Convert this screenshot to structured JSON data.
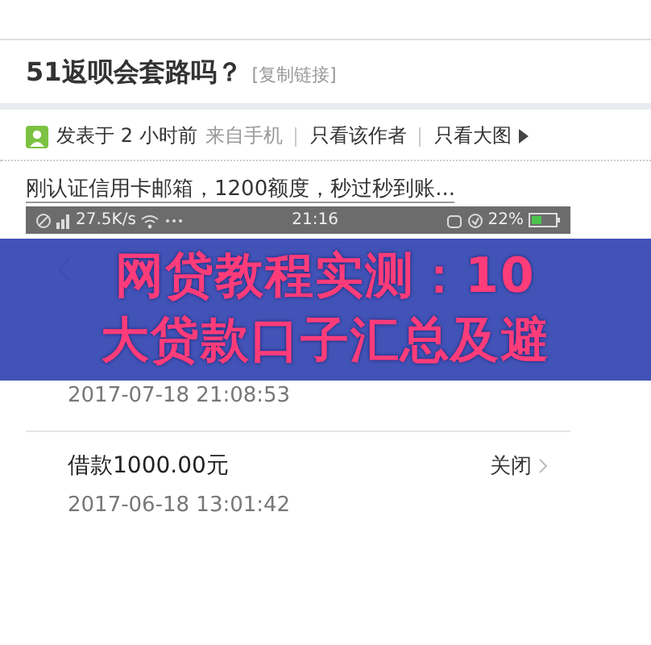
{
  "post": {
    "title": "51返呗会套路吗？",
    "copy_link": "[复制链接]",
    "meta": {
      "posted": "发表于 2 小时前",
      "source": "来自手机",
      "links": [
        "只看该作者",
        "只看大图"
      ]
    },
    "text": "刚认证信用卡邮箱，1200额度，秒过秒到账..."
  },
  "screenshot": {
    "status_bar": {
      "speed": "27.5K/s",
      "time": "21:16",
      "battery": "22%"
    },
    "records": [
      {
        "date": "2017-07-18 21:08:53"
      },
      {
        "amount": "借款1000.00元",
        "status": "关闭",
        "date": "2017-06-18 13:01:42"
      }
    ]
  },
  "overlay": {
    "lines": [
      "网贷教程实测：10",
      "大贷款口子汇总及避"
    ]
  }
}
